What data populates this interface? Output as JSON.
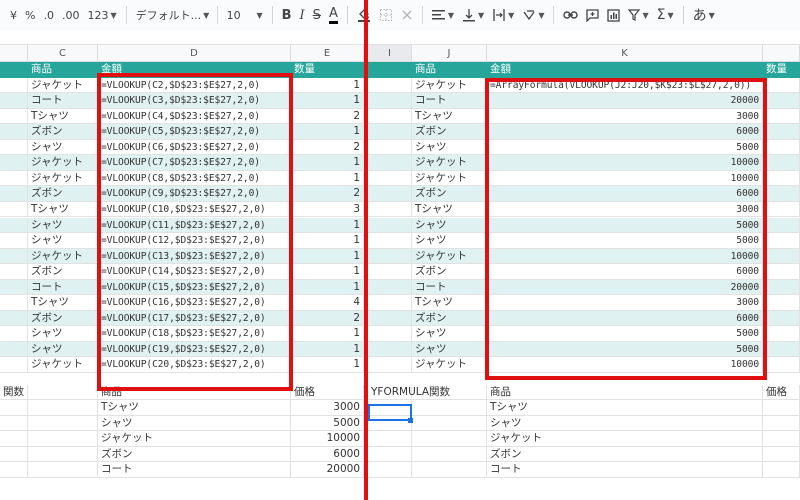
{
  "toolbar": {
    "currency": "¥",
    "percent": "%",
    "dec_decrease": ".0",
    "dec_increase": ".00",
    "format_more": "123",
    "font_name": "デフォルト...",
    "font_size": "10",
    "bold": "B",
    "italic": "I",
    "strike": "S",
    "text_color": "A",
    "input_tools": "あ",
    "icons": [
      "paint-bucket-icon",
      "borders-icon",
      "merge-icon",
      "align-left-icon",
      "valign-bottom-icon",
      "text-wrap-icon",
      "text-rotate-icon",
      "link-icon",
      "comment-icon",
      "chart-icon",
      "filter-icon",
      "sigma-icon"
    ]
  },
  "columns": {
    "left": [
      "C",
      "D",
      "E"
    ],
    "right": [
      "I",
      "J",
      "K"
    ]
  },
  "left_table": {
    "headers": {
      "item": "商品",
      "amount": "金額",
      "qty": "数量"
    },
    "rows": [
      {
        "item": "ジャケット",
        "formula": "=VLOOKUP(C2,$D$23:$E$27,2,0)",
        "qty": "1"
      },
      {
        "item": "コート",
        "formula": "=VLOOKUP(C3,$D$23:$E$27,2,0)",
        "qty": "1"
      },
      {
        "item": "Tシャツ",
        "formula": "=VLOOKUP(C4,$D$23:$E$27,2,0)",
        "qty": "2"
      },
      {
        "item": "ズボン",
        "formula": "=VLOOKUP(C5,$D$23:$E$27,2,0)",
        "qty": "1"
      },
      {
        "item": "シャツ",
        "formula": "=VLOOKUP(C6,$D$23:$E$27,2,0)",
        "qty": "2"
      },
      {
        "item": "ジャケット",
        "formula": "=VLOOKUP(C7,$D$23:$E$27,2,0)",
        "qty": "1"
      },
      {
        "item": "ジャケット",
        "formula": "=VLOOKUP(C8,$D$23:$E$27,2,0)",
        "qty": "1"
      },
      {
        "item": "ズボン",
        "formula": "=VLOOKUP(C9,$D$23:$E$27,2,0)",
        "qty": "2"
      },
      {
        "item": "Tシャツ",
        "formula": "=VLOOKUP(C10,$D$23:$E$27,2,0)",
        "qty": "3"
      },
      {
        "item": "シャツ",
        "formula": "=VLOOKUP(C11,$D$23:$E$27,2,0)",
        "qty": "1"
      },
      {
        "item": "シャツ",
        "formula": "=VLOOKUP(C12,$D$23:$E$27,2,0)",
        "qty": "1"
      },
      {
        "item": "ジャケット",
        "formula": "=VLOOKUP(C13,$D$23:$E$27,2,0)",
        "qty": "1"
      },
      {
        "item": "ズボン",
        "formula": "=VLOOKUP(C14,$D$23:$E$27,2,0)",
        "qty": "1"
      },
      {
        "item": "コート",
        "formula": "=VLOOKUP(C15,$D$23:$E$27,2,0)",
        "qty": "1"
      },
      {
        "item": "Tシャツ",
        "formula": "=VLOOKUP(C16,$D$23:$E$27,2,0)",
        "qty": "4"
      },
      {
        "item": "ズボン",
        "formula": "=VLOOKUP(C17,$D$23:$E$27,2,0)",
        "qty": "2"
      },
      {
        "item": "シャツ",
        "formula": "=VLOOKUP(C18,$D$23:$E$27,2,0)",
        "qty": "1"
      },
      {
        "item": "シャツ",
        "formula": "=VLOOKUP(C19,$D$23:$E$27,2,0)",
        "qty": "1"
      },
      {
        "item": "ジャケット",
        "formula": "=VLOOKUP(C20,$D$23:$E$27,2,0)",
        "qty": "1"
      }
    ],
    "lookup_label": "関数",
    "lookup_headers": {
      "item": "商品",
      "price": "価格"
    },
    "lookup": [
      {
        "item": "Tシャツ",
        "price": "3000"
      },
      {
        "item": "シャツ",
        "price": "5000"
      },
      {
        "item": "ジャケット",
        "price": "10000"
      },
      {
        "item": "ズボン",
        "price": "6000"
      },
      {
        "item": "コート",
        "price": "20000"
      }
    ]
  },
  "right_table": {
    "headers": {
      "item": "商品",
      "amount": "金額",
      "qty": "数量"
    },
    "array_formula": "=ArrayFormula(VLOOKUP(J2:J20,$K$23:$L$27,2,0))",
    "rows": [
      {
        "item": "ジャケット",
        "amount": ""
      },
      {
        "item": "コート",
        "amount": "20000"
      },
      {
        "item": "Tシャツ",
        "amount": "3000"
      },
      {
        "item": "ズボン",
        "amount": "6000"
      },
      {
        "item": "シャツ",
        "amount": "5000"
      },
      {
        "item": "ジャケット",
        "amount": "10000"
      },
      {
        "item": "ジャケット",
        "amount": "10000"
      },
      {
        "item": "ズボン",
        "amount": "6000"
      },
      {
        "item": "Tシャツ",
        "amount": "3000"
      },
      {
        "item": "シャツ",
        "amount": "5000"
      },
      {
        "item": "シャツ",
        "amount": "5000"
      },
      {
        "item": "ジャケット",
        "amount": "10000"
      },
      {
        "item": "ズボン",
        "amount": "6000"
      },
      {
        "item": "コート",
        "amount": "20000"
      },
      {
        "item": "Tシャツ",
        "amount": "3000"
      },
      {
        "item": "ズボン",
        "amount": "6000"
      },
      {
        "item": "シャツ",
        "amount": "5000"
      },
      {
        "item": "シャツ",
        "amount": "5000"
      },
      {
        "item": "ジャケット",
        "amount": "10000"
      }
    ],
    "lookup_label": "YFORMULA関数",
    "lookup_headers": {
      "item": "商品",
      "price": "価格"
    },
    "lookup": [
      {
        "item": "Tシャツ"
      },
      {
        "item": "シャツ"
      },
      {
        "item": "ジャケット"
      },
      {
        "item": "ズボン"
      },
      {
        "item": "コート"
      }
    ]
  },
  "colors": {
    "header_teal": "#26a69a",
    "band_teal": "#dff1f0",
    "annotation_red": "#e01010",
    "selection_blue": "#1a73e8"
  }
}
